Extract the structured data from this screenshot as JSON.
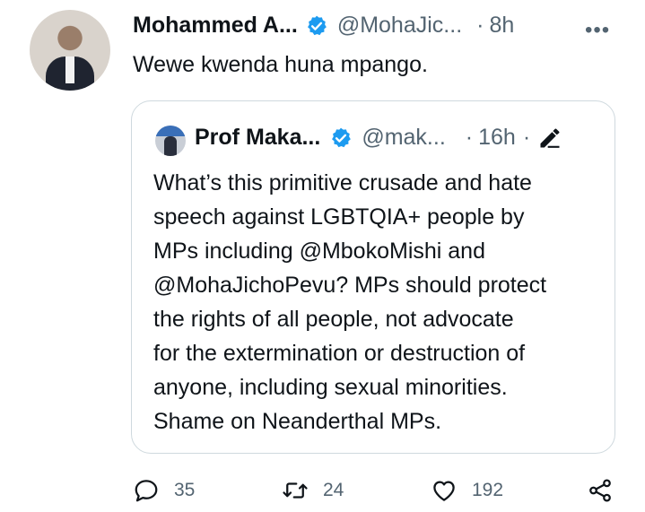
{
  "tweet": {
    "author_name": "Mohammed A...",
    "author_handle": "@MohaJic...",
    "separator": "·",
    "time": "8h",
    "more_label": "•••",
    "text": "Wewe kwenda huna mpango."
  },
  "quoted_tweet": {
    "author_name": "Prof Maka...",
    "author_handle": "@mak...",
    "separator": "·",
    "time": "16h",
    "separator2": "·",
    "lines": [
      "What’s this primitive crusade and hate",
      "speech against LGBTQIA+ people by",
      "MPs including @MbokoMishi and",
      "@MohaJichoPevu?  MPs should protect",
      "the rights of all people, not advocate",
      "for the extermination or destruction of",
      "anyone, including sexual minorities.",
      "Shame on Neanderthal MPs."
    ]
  },
  "actions": {
    "replies": "35",
    "retweets": "24",
    "likes": "192"
  },
  "colors": {
    "verified": "#1d9bf0",
    "muted_text": "#536471",
    "border": "#cfd9de"
  }
}
